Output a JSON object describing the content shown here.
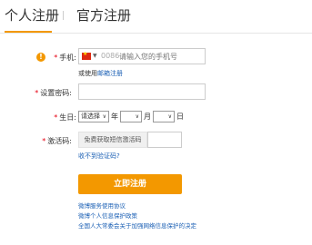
{
  "tabs": {
    "personal": "个人注册",
    "official": "官方注册"
  },
  "phone": {
    "label": "手机:",
    "country_code": "0086",
    "placeholder": "请输入您的手机号",
    "email_prefix": "或使用",
    "email_link": "邮箱注册"
  },
  "password": {
    "label": "设置密码:"
  },
  "birthday": {
    "label": "生日:",
    "select_placeholder": "请选择",
    "year_unit": "年",
    "month_unit": "月",
    "day_unit": "日"
  },
  "activation": {
    "label": "激活码:",
    "get_code_button": "免费获取短信激活码",
    "no_code_link": "收不到验证码?"
  },
  "register_button": "立即注册",
  "agreements": [
    "微博服务使用协议",
    "微博个人信息保护政策",
    "全国人大常委会关于加强网络信息保护的决定"
  ],
  "colors": {
    "accent": "#f39800",
    "link": "#1a5fb4",
    "required": "#e60012"
  }
}
